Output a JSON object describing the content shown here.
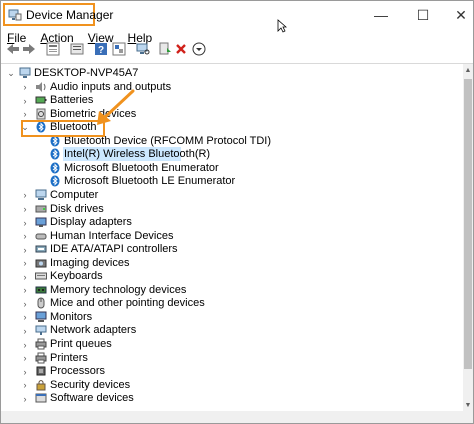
{
  "window": {
    "title": "Device Manager",
    "controls": {
      "minimize": "—",
      "maximize": "☐",
      "close": "✕"
    }
  },
  "menu": [
    {
      "label": "File",
      "underline": "F",
      "rest": "ile"
    },
    {
      "label": "Action",
      "underline": "A",
      "rest": "ction"
    },
    {
      "label": "View",
      "underline": "V",
      "rest": "iew"
    },
    {
      "label": "Help",
      "underline": "H",
      "rest": "elp"
    }
  ],
  "toolbar": {
    "icons": [
      "back-arrow-icon",
      "forward-arrow-icon",
      "computer-view-icon",
      "properties-icon",
      "help-icon",
      "show-hidden-icon",
      "scan-hardware-icon",
      "update-driver-icon",
      "uninstall-icon",
      "disable-icon"
    ]
  },
  "colors": {
    "highlight": "#f0921e",
    "selection": "#cce8ff",
    "bluetooth": "#1d6fc6"
  },
  "tree": {
    "root": "DESKTOP-NVP45A7",
    "items": [
      {
        "label": "Audio inputs and outputs",
        "icon": "speaker-icon",
        "expanded": false
      },
      {
        "label": "Batteries",
        "icon": "battery-icon",
        "expanded": false
      },
      {
        "label": "Biometric devices",
        "icon": "biometric-icon",
        "expanded": false
      },
      {
        "label": "Bluetooth",
        "icon": "bluetooth-icon",
        "expanded": true,
        "children": [
          "Bluetooth Device (RFCOMM Protocol TDI)",
          "Intel(R) Wireless Bluetooth(R)",
          "Microsoft Bluetooth Enumerator",
          "Microsoft Bluetooth LE Enumerator"
        ]
      },
      {
        "label": "Computer",
        "icon": "computer-icon",
        "expanded": false
      },
      {
        "label": "Disk drives",
        "icon": "disk-icon",
        "expanded": false
      },
      {
        "label": "Display adapters",
        "icon": "display-icon",
        "expanded": false
      },
      {
        "label": "Human Interface Devices",
        "icon": "hid-icon",
        "expanded": false
      },
      {
        "label": "IDE ATA/ATAPI controllers",
        "icon": "ide-icon",
        "expanded": false
      },
      {
        "label": "Imaging devices",
        "icon": "camera-icon",
        "expanded": false
      },
      {
        "label": "Keyboards",
        "icon": "keyboard-icon",
        "expanded": false
      },
      {
        "label": "Memory technology devices",
        "icon": "memory-icon",
        "expanded": false
      },
      {
        "label": "Mice and other pointing devices",
        "icon": "mouse-icon",
        "expanded": false
      },
      {
        "label": "Monitors",
        "icon": "monitor-icon",
        "expanded": false
      },
      {
        "label": "Network adapters",
        "icon": "network-icon",
        "expanded": false
      },
      {
        "label": "Print queues",
        "icon": "printer-icon",
        "expanded": false
      },
      {
        "label": "Printers",
        "icon": "printer-icon",
        "expanded": false
      },
      {
        "label": "Processors",
        "icon": "processor-icon",
        "expanded": false
      },
      {
        "label": "Security devices",
        "icon": "security-icon",
        "expanded": false
      },
      {
        "label": "Software devices",
        "icon": "software-icon",
        "expanded": false
      }
    ],
    "selected_child": "Intel(R) Wireless Bluetooth(R)"
  }
}
